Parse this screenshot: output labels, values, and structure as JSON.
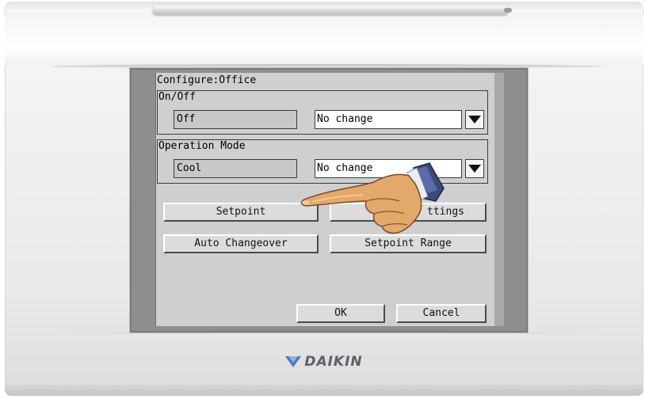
{
  "device": {
    "brand": "DAIKIN"
  },
  "dialog": {
    "title": "Configure:Office",
    "on_off": {
      "label": "On/Off",
      "current_value": "Off",
      "selected_option": "No change"
    },
    "operation_mode": {
      "label": "Operation Mode",
      "current_value": "Cool",
      "selected_option": "No change"
    },
    "buttons": {
      "setpoint": "Setpoint",
      "fan_settings": "ttings",
      "auto_changeover": "Auto Changeover",
      "setpoint_range": "Setpoint Range",
      "ok": "OK",
      "cancel": "Cancel"
    }
  },
  "icons": {
    "dropdown": "triangle-down-icon",
    "pointer": "pointing-hand-icon",
    "logo": "daikin-logo-icon"
  },
  "colors": {
    "screen_bg": "#cfcfcf",
    "bezel": "#8e8e8e",
    "logo": "#5a5f6a"
  }
}
